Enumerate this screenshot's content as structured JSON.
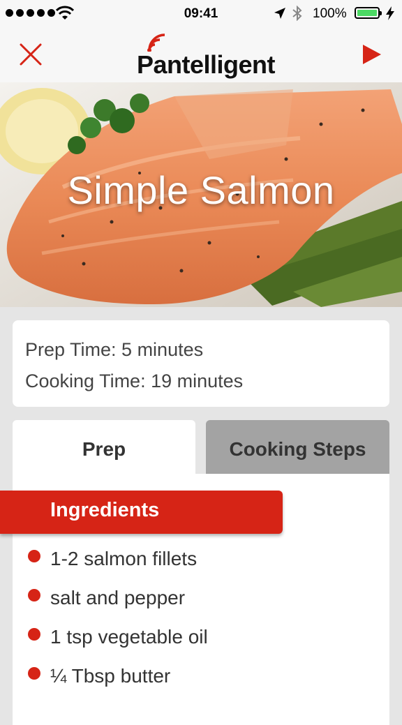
{
  "status_bar": {
    "time": "09:41",
    "battery": "100%"
  },
  "nav": {
    "logo_text": "Pantelligent",
    "close_icon": "close-icon",
    "play_icon": "play-icon"
  },
  "recipe": {
    "title": "Simple Salmon",
    "prep_time": "Prep Time: 5 minutes",
    "cooking_time": "Cooking Time: 19 minutes"
  },
  "tabs": [
    {
      "label": "Prep",
      "active": true
    },
    {
      "label": "Cooking Steps",
      "active": false
    }
  ],
  "ingredients": {
    "header": "Ingredients",
    "items": [
      "1-2 salmon fillets",
      "salt and pepper",
      "1 tsp vegetable oil",
      "¼ Tbsp butter"
    ]
  },
  "colors": {
    "accent": "#d62416",
    "inactive_tab": "#a3a3a3",
    "battery": "#4cd964"
  }
}
